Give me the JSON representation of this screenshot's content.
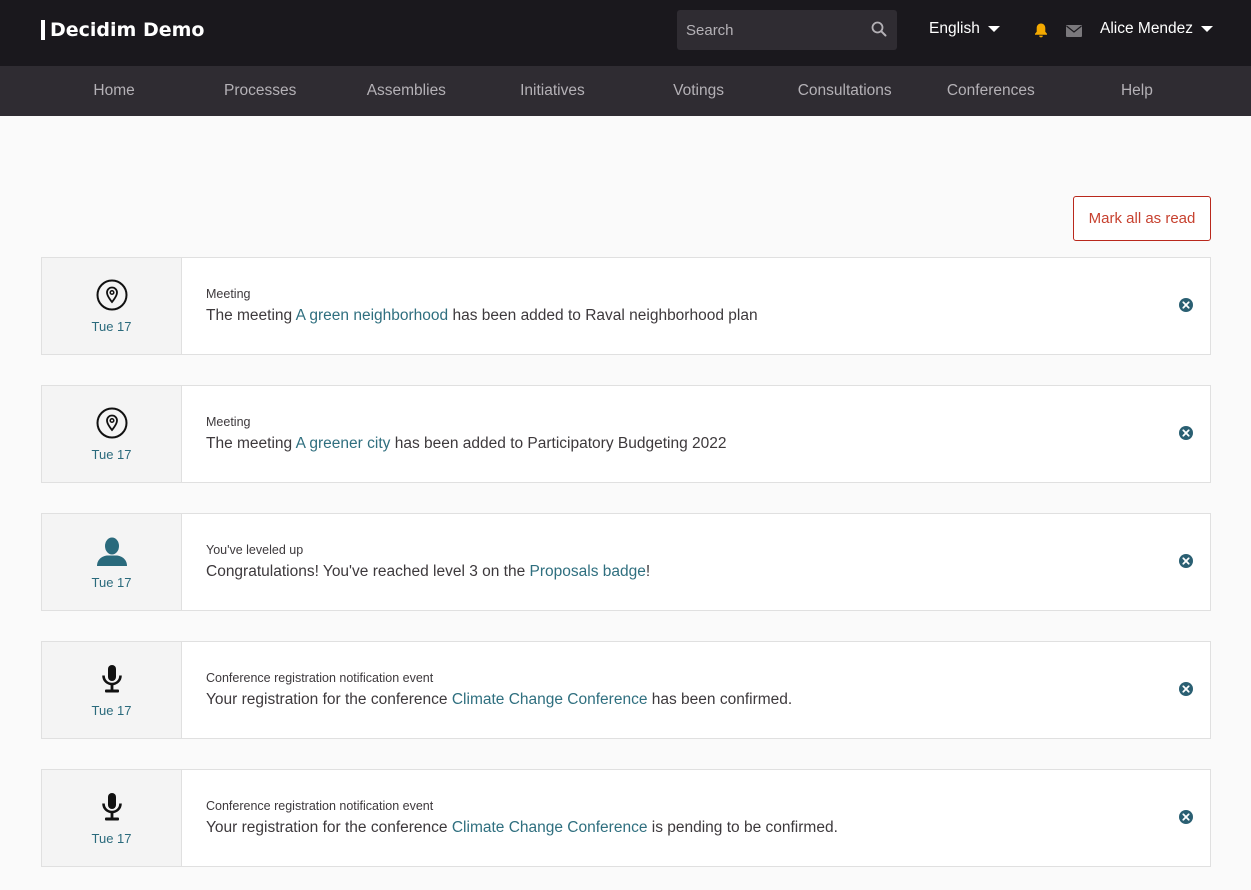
{
  "header": {
    "logo": "Decidim Demo",
    "search_placeholder": "Search",
    "language": "English",
    "user_name": "Alice Mendez"
  },
  "nav": [
    "Home",
    "Processes",
    "Assemblies",
    "Initiatives",
    "Votings",
    "Consultations",
    "Conferences",
    "Help"
  ],
  "mark_all_label": "Mark all as read",
  "notifications": [
    {
      "icon": "map-pin-icon",
      "date": "Tue 17",
      "type": "Meeting",
      "text_before": "The meeting ",
      "link": "A green neighborhood",
      "text_after": " has been added to Raval neighborhood plan"
    },
    {
      "icon": "map-pin-icon",
      "date": "Tue 17",
      "type": "Meeting",
      "text_before": "The meeting ",
      "link": "A greener city",
      "text_after": " has been added to Participatory Budgeting 2022"
    },
    {
      "icon": "user-icon",
      "date": "Tue 17",
      "type": "You've leveled up",
      "text_before": "Congratulations! You've reached level 3 on the ",
      "link": "Proposals badge",
      "text_after": "!"
    },
    {
      "icon": "microphone-icon",
      "date": "Tue 17",
      "type": "Conference registration notification event",
      "text_before": "Your registration for the conference ",
      "link": "Climate Change Conference",
      "text_after": " has been confirmed."
    },
    {
      "icon": "microphone-icon",
      "date": "Tue 17",
      "type": "Conference registration notification event",
      "text_before": "Your registration for the conference ",
      "link": "Climate Change Conference",
      "text_after": " is pending to be confirmed."
    }
  ],
  "colors": {
    "topbar": "#1a181d",
    "navbar": "#2f2c32",
    "link": "#2f6f7f",
    "alert": "#c7412f",
    "bell": "#f4a900"
  }
}
